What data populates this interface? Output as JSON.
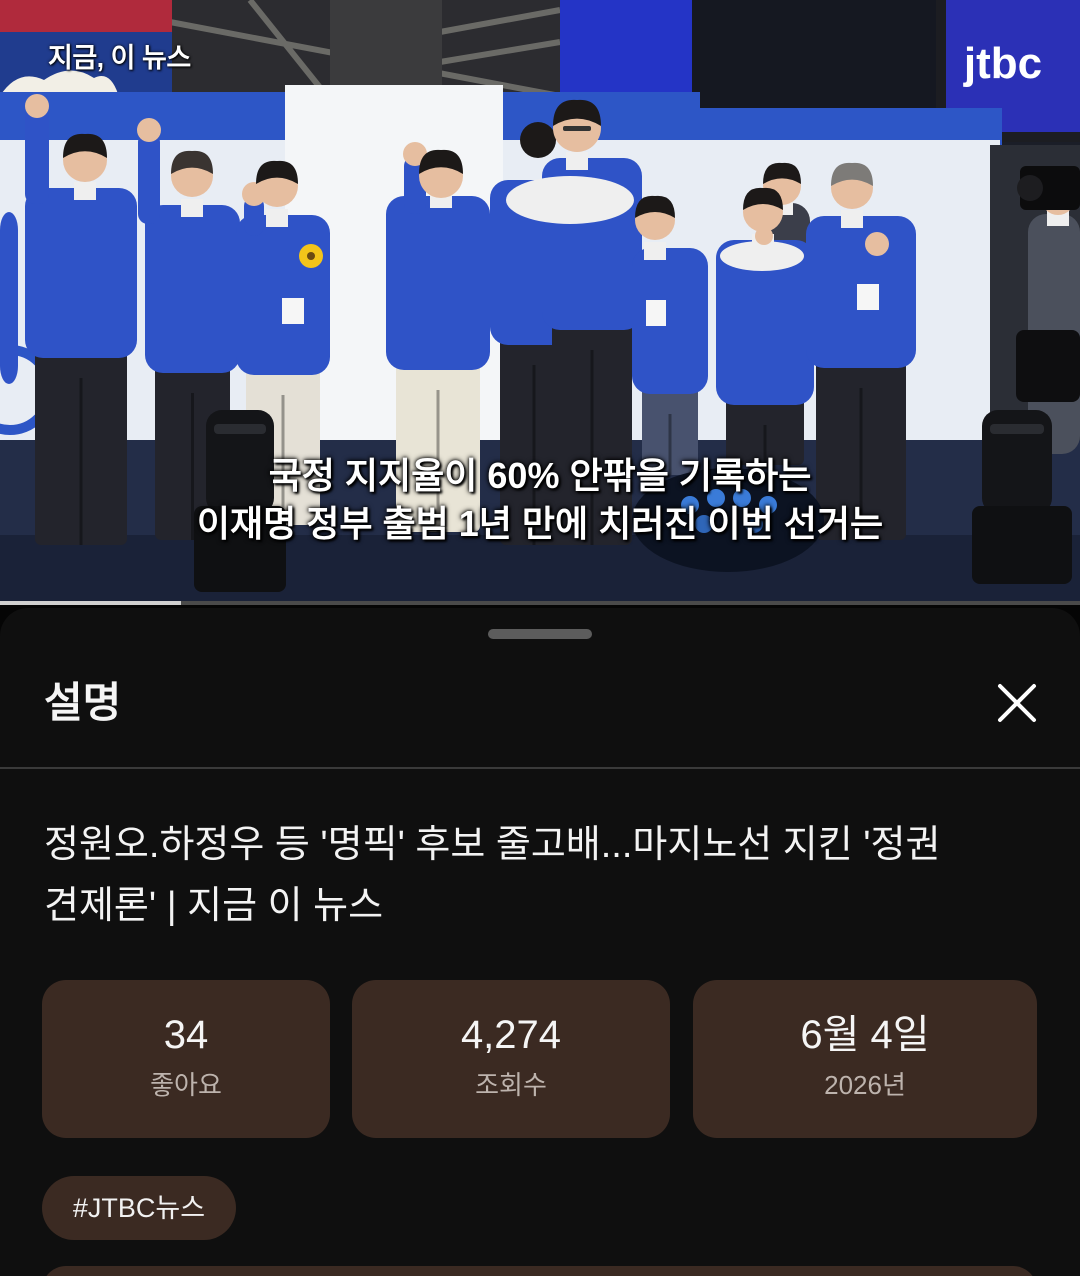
{
  "video": {
    "program_label": "지금, 이 뉴스",
    "logo": "jtbc",
    "subtitle_lines": [
      "국정 지지율이 60% 안팎을 기록하는",
      "이재명 정부 출범 1년 만에 치러진 이번 선거는"
    ],
    "progress": 0.168
  },
  "sheet": {
    "heading": "설명",
    "close_icon": "close-icon",
    "title": "정원오.하정우 등 '명픽' 후보 줄고배...마지노선 지킨 '정권 견제론' | 지금 이 뉴스",
    "stats": [
      {
        "value": "34",
        "label": "좋아요"
      },
      {
        "value": "4,274",
        "label": "조회수"
      },
      {
        "value": "6월 4일",
        "label": "2026년"
      }
    ],
    "tags": [
      "#JTBC뉴스"
    ]
  },
  "colors": {
    "sheet_background": "#0f0f0f",
    "card_background": "#3b2a22",
    "progress_played": "#d0d0d0",
    "progress_track": "#4a4a4a",
    "jacket_blue": "#2f53c7"
  }
}
